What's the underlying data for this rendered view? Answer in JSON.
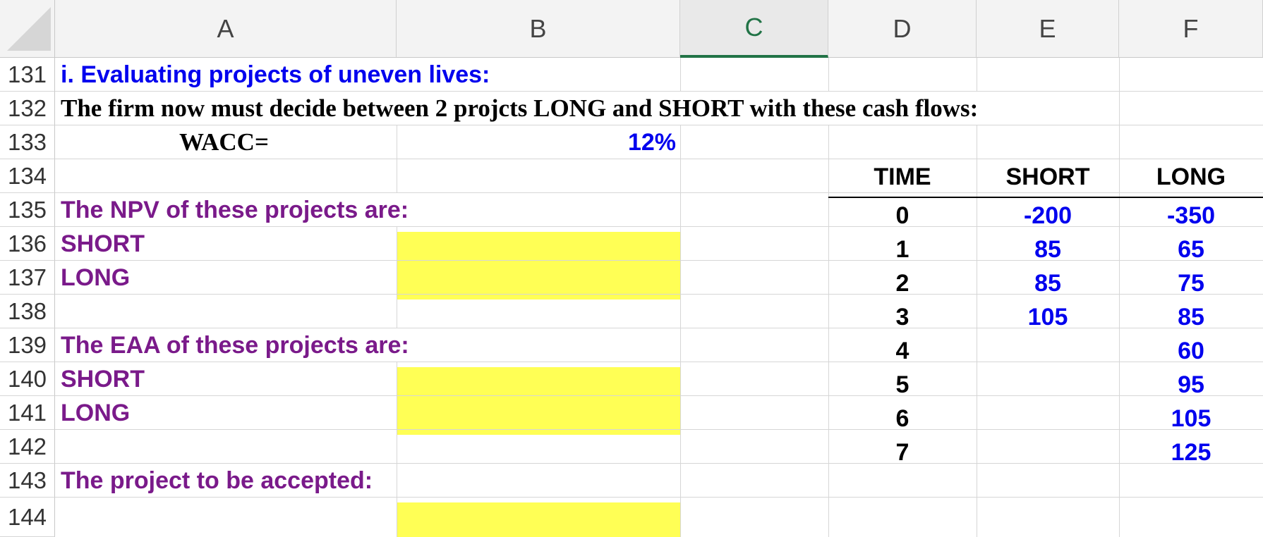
{
  "columns": [
    "A",
    "B",
    "C",
    "D",
    "E",
    "F"
  ],
  "active_column": "C",
  "rows": [
    "131",
    "132",
    "133",
    "134",
    "135",
    "136",
    "137",
    "138",
    "139",
    "140",
    "141",
    "142",
    "143",
    "144"
  ],
  "content": {
    "r131_title": "i.   Evaluating projects of uneven lives:",
    "r132_text": "The firm now must decide between 2 projcts LONG and SHORT with these cash flows:",
    "r133_label": "WACC=",
    "r133_value": "12%",
    "r135_label": "The NPV of these projects are:",
    "r136_label": "SHORT",
    "r137_label": "LONG",
    "r139_label": "The EAA of these projects are:",
    "r140_label": "SHORT",
    "r141_label": "LONG",
    "r143_label": "The project to be accepted:"
  },
  "cashflow_table": {
    "headers": [
      "TIME",
      "SHORT",
      "LONG"
    ],
    "time": [
      "0",
      "1",
      "2",
      "3",
      "4",
      "5",
      "6",
      "7"
    ],
    "short": [
      "-200",
      "85",
      "85",
      "105",
      "",
      "",
      "",
      ""
    ],
    "long": [
      "-350",
      "65",
      "75",
      "85",
      "60",
      "95",
      "105",
      "125"
    ]
  },
  "colors": {
    "blue": "#0000ee",
    "purple": "#7a1a8a",
    "yellow_fill": "#ffff55",
    "active_header": "#217346"
  }
}
